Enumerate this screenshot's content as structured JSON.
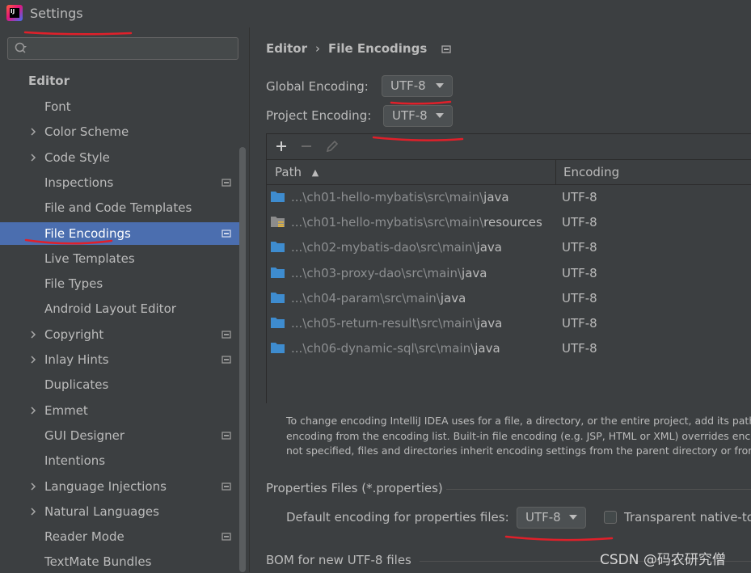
{
  "window": {
    "title": "Settings",
    "logo_text": "IJ"
  },
  "search": {
    "placeholder": ""
  },
  "sidebar": {
    "section": "Editor",
    "items": [
      {
        "label": "Font",
        "chevron": false,
        "badge": false
      },
      {
        "label": "Color Scheme",
        "chevron": true,
        "badge": false
      },
      {
        "label": "Code Style",
        "chevron": true,
        "badge": false
      },
      {
        "label": "Inspections",
        "chevron": false,
        "badge": true
      },
      {
        "label": "File and Code Templates",
        "chevron": false,
        "badge": false
      },
      {
        "label": "File Encodings",
        "chevron": false,
        "badge": true,
        "selected": true
      },
      {
        "label": "Live Templates",
        "chevron": false,
        "badge": false
      },
      {
        "label": "File Types",
        "chevron": false,
        "badge": false
      },
      {
        "label": "Android Layout Editor",
        "chevron": false,
        "badge": false
      },
      {
        "label": "Copyright",
        "chevron": true,
        "badge": true
      },
      {
        "label": "Inlay Hints",
        "chevron": true,
        "badge": true
      },
      {
        "label": "Duplicates",
        "chevron": false,
        "badge": false
      },
      {
        "label": "Emmet",
        "chevron": true,
        "badge": false
      },
      {
        "label": "GUI Designer",
        "chevron": false,
        "badge": true
      },
      {
        "label": "Intentions",
        "chevron": false,
        "badge": false
      },
      {
        "label": "Language Injections",
        "chevron": true,
        "badge": true
      },
      {
        "label": "Natural Languages",
        "chevron": true,
        "badge": false
      },
      {
        "label": "Reader Mode",
        "chevron": false,
        "badge": true
      },
      {
        "label": "TextMate Bundles",
        "chevron": false,
        "badge": false
      }
    ]
  },
  "breadcrumb": {
    "parent": "Editor",
    "separator": "›",
    "current": "File Encodings"
  },
  "global_encoding": {
    "label": "Global Encoding:",
    "value": "UTF-8"
  },
  "project_encoding": {
    "label": "Project Encoding:",
    "value": "UTF-8"
  },
  "table": {
    "col_path": "Path",
    "col_encoding": "Encoding",
    "sort_indicator": "▲",
    "rows": [
      {
        "prefix": "...\\ch01-hello-mybatis\\src\\main\\",
        "leaf": "java",
        "encoding": "UTF-8",
        "icon": "source-folder-icon"
      },
      {
        "prefix": "...\\ch01-hello-mybatis\\src\\main\\",
        "leaf": "resources",
        "encoding": "UTF-8",
        "icon": "resources-folder-icon"
      },
      {
        "prefix": "...\\ch02-mybatis-dao\\src\\main\\",
        "leaf": "java",
        "encoding": "UTF-8",
        "icon": "source-folder-icon"
      },
      {
        "prefix": "...\\ch03-proxy-dao\\src\\main\\",
        "leaf": "java",
        "encoding": "UTF-8",
        "icon": "source-folder-icon"
      },
      {
        "prefix": "...\\ch04-param\\src\\main\\",
        "leaf": "java",
        "encoding": "UTF-8",
        "icon": "source-folder-icon"
      },
      {
        "prefix": "...\\ch05-return-result\\src\\main\\",
        "leaf": "java",
        "encoding": "UTF-8",
        "icon": "source-folder-icon"
      },
      {
        "prefix": "...\\ch06-dynamic-sql\\src\\main\\",
        "leaf": "java",
        "encoding": "UTF-8",
        "icon": "source-folder-icon"
      }
    ]
  },
  "help": {
    "line1": "To change encoding IntelliJ IDEA uses for a file, a directory, or the entire project, add its path i",
    "line2": "encoding from the encoding list. Built-in file encoding (e.g. JSP, HTML or XML) overrides enco",
    "line3": "not specified, files and directories inherit encoding settings from the parent directory or from"
  },
  "properties": {
    "group_title": "Properties Files (*.properties)",
    "default_label": "Default encoding for properties files:",
    "default_value": "UTF-8",
    "transparent_label": "Transparent native-to",
    "transparent_checked": false
  },
  "bom": {
    "group_title": "BOM for new UTF-8 files"
  },
  "watermark": "CSDN @码农研究僧",
  "colors": {
    "accent_selection": "#4b6eaf",
    "annotation_red": "#e0202a",
    "background": "#3c3f41"
  }
}
